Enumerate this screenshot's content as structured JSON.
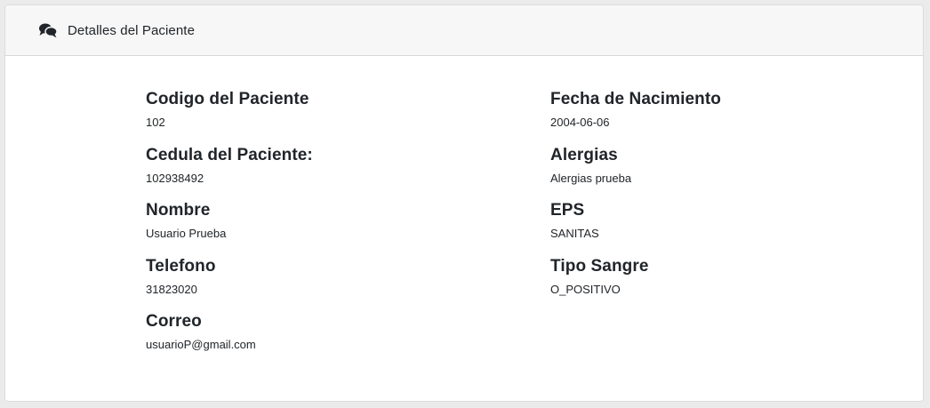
{
  "header": {
    "title": "Detalles del Paciente",
    "icon": "comments-icon"
  },
  "left_fields": [
    {
      "label": "Codigo del Paciente",
      "value": "102"
    },
    {
      "label": "Cedula del Paciente:",
      "value": "102938492"
    },
    {
      "label": "Nombre",
      "value": "Usuario Prueba"
    },
    {
      "label": "Telefono",
      "value": "31823020"
    },
    {
      "label": "Correo",
      "value": "usuarioP@gmail.com"
    }
  ],
  "right_fields": [
    {
      "label": "Fecha de Nacimiento",
      "value": "2004-06-06"
    },
    {
      "label": "Alergias",
      "value": "Alergias prueba"
    },
    {
      "label": "EPS",
      "value": "SANITAS"
    },
    {
      "label": "Tipo Sangre",
      "value": "O_POSITIVO"
    }
  ],
  "colors": {
    "page_background": "#ebebeb",
    "header_background": "#f7f7f7",
    "text": "#212529"
  }
}
